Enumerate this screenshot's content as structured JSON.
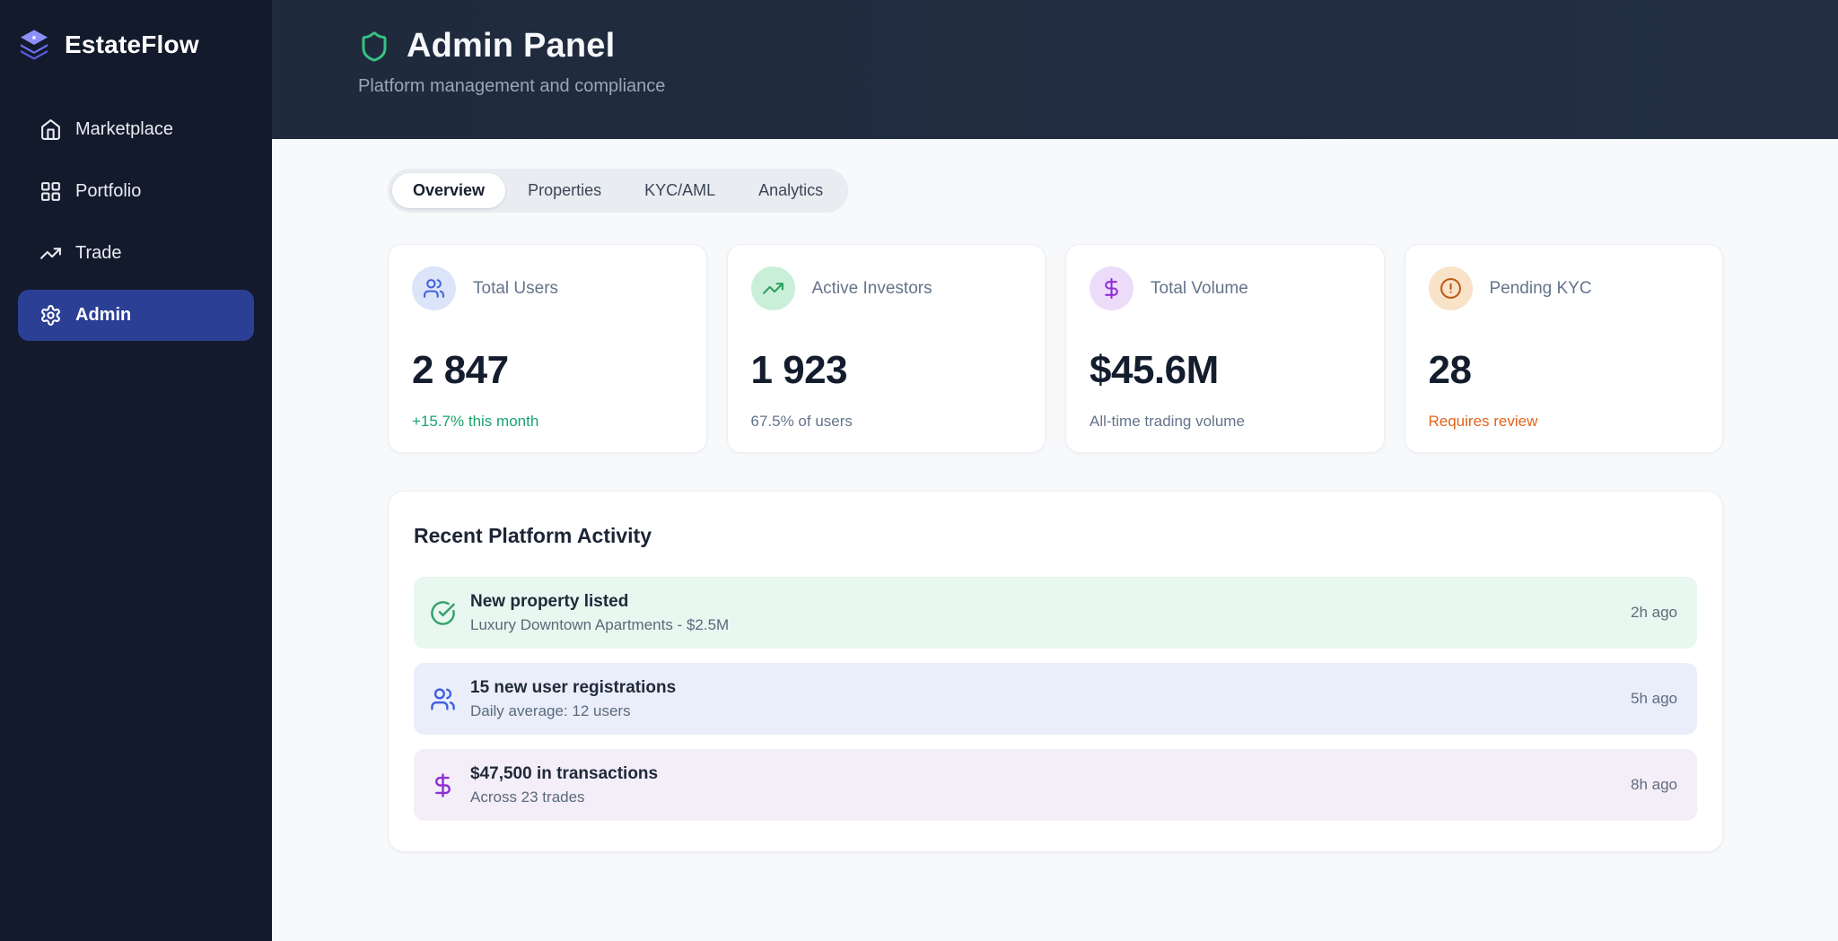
{
  "brand": {
    "name": "EstateFlow"
  },
  "sidebar": {
    "items": [
      {
        "label": "Marketplace",
        "icon": "home-icon",
        "active": false
      },
      {
        "label": "Portfolio",
        "icon": "grid-icon",
        "active": false
      },
      {
        "label": "Trade",
        "icon": "trending-up-icon",
        "active": false
      },
      {
        "label": "Admin",
        "icon": "gear-icon",
        "active": true
      }
    ],
    "active_bg": "#2b3f94",
    "bg": "#131a2b"
  },
  "header": {
    "title": "Admin Panel",
    "subtitle": "Platform management and compliance",
    "shield_color": "#37c184"
  },
  "tabs": [
    {
      "label": "Overview",
      "active": true
    },
    {
      "label": "Properties",
      "active": false
    },
    {
      "label": "KYC/AML",
      "active": false
    },
    {
      "label": "Analytics",
      "active": false
    }
  ],
  "stats": [
    {
      "label": "Total Users",
      "value": "2 847",
      "note": "+15.7% this month",
      "icon": "users-icon",
      "icon_color": "#4060dd",
      "icon_bg": "#dbe4f8",
      "note_color": "#18a46f"
    },
    {
      "label": "Active Investors",
      "value": "1 923",
      "note": "67.5% of users",
      "icon": "trending-up-icon",
      "icon_color": "#2f9e63",
      "icon_bg": "#c9efd8",
      "note_color": "#64748b"
    },
    {
      "label": "Total Volume",
      "value": "$45.6M",
      "note": "All-time trading volume",
      "icon": "dollar-icon",
      "icon_color": "#8e2fd4",
      "icon_bg": "#eddcf9",
      "note_color": "#64748b"
    },
    {
      "label": "Pending KYC",
      "value": "28",
      "note": "Requires review",
      "icon": "alert-circle-icon",
      "icon_color": "#bf5a16",
      "icon_bg": "#f8e3c8",
      "note_color": "#e2641c"
    }
  ],
  "activity": {
    "title": "Recent Platform Activity",
    "items": [
      {
        "title": "New property listed",
        "subtitle": "Luxury Downtown Apartments - $2.5M",
        "time": "2h ago",
        "icon": "check-circle-icon",
        "bg": "#e8f7ef",
        "icon_color": "#35a16b"
      },
      {
        "title": "15 new user registrations",
        "subtitle": "Daily average: 12 users",
        "time": "5h ago",
        "icon": "users-icon",
        "bg": "#e9eefa",
        "icon_color": "#4060dd"
      },
      {
        "title": "$47,500 in transactions",
        "subtitle": "Across 23 trades",
        "time": "8h ago",
        "icon": "dollar-icon",
        "bg": "#f4eef8",
        "icon_color": "#8e2fd4"
      }
    ]
  }
}
